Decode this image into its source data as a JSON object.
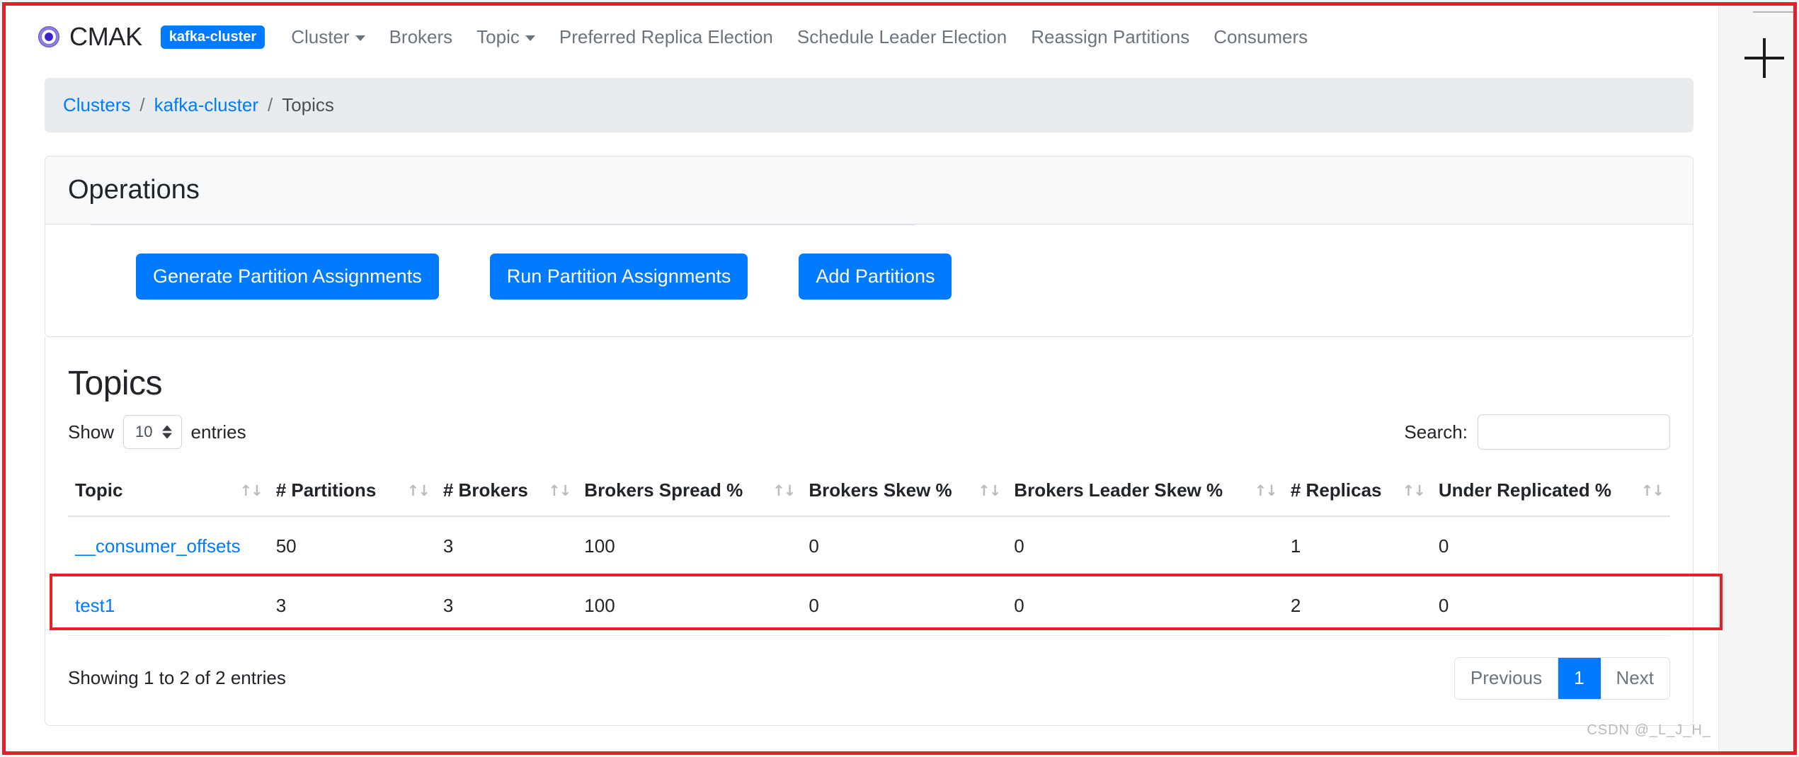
{
  "navbar": {
    "brand": "CMAK",
    "brand_icon": "cmak-logo-icon",
    "cluster_badge": "kafka-cluster",
    "items": [
      {
        "label": "Cluster",
        "has_caret": true
      },
      {
        "label": "Brokers",
        "has_caret": false
      },
      {
        "label": "Topic",
        "has_caret": true
      },
      {
        "label": "Preferred Replica Election",
        "has_caret": false
      },
      {
        "label": "Schedule Leader Election",
        "has_caret": false
      },
      {
        "label": "Reassign Partitions",
        "has_caret": false
      },
      {
        "label": "Consumers",
        "has_caret": false
      }
    ]
  },
  "breadcrumb": {
    "items": [
      {
        "label": "Clusters",
        "link": true
      },
      {
        "label": "kafka-cluster",
        "link": true
      },
      {
        "label": "Topics",
        "link": false
      }
    ],
    "separator": "/"
  },
  "operations": {
    "title": "Operations",
    "buttons": [
      {
        "label": "Generate Partition Assignments"
      },
      {
        "label": "Run Partition Assignments"
      },
      {
        "label": "Add Partitions"
      }
    ]
  },
  "topics": {
    "title": "Topics",
    "length_menu": {
      "prefix": "Show",
      "value": "10",
      "suffix": "entries"
    },
    "search": {
      "label": "Search:",
      "value": "",
      "placeholder": ""
    },
    "columns": [
      "Topic",
      "# Partitions",
      "# Brokers",
      "Brokers Spread %",
      "Brokers Skew %",
      "Brokers Leader Skew %",
      "# Replicas",
      "Under Replicated %"
    ],
    "sort_icon": "↑↓",
    "rows": [
      {
        "topic": "__consumer_offsets",
        "partitions": "50",
        "brokers": "3",
        "brokers_spread": "100",
        "brokers_skew": "0",
        "brokers_leader_skew": "0",
        "replicas": "1",
        "under_replicated": "0"
      },
      {
        "topic": "test1",
        "partitions": "3",
        "brokers": "3",
        "brokers_spread": "100",
        "brokers_skew": "0",
        "brokers_leader_skew": "0",
        "replicas": "2",
        "under_replicated": "0"
      }
    ],
    "info": "Showing 1 to 2 of 2 entries",
    "pagination": {
      "previous": "Previous",
      "current": "1",
      "next": "Next"
    }
  },
  "watermark": "CSDN @_L_J_H_",
  "colors": {
    "accent": "#007bff",
    "annotation": "#e81f28",
    "muted": "#6c757d",
    "breadcrumb_bg": "#e9ecef"
  }
}
